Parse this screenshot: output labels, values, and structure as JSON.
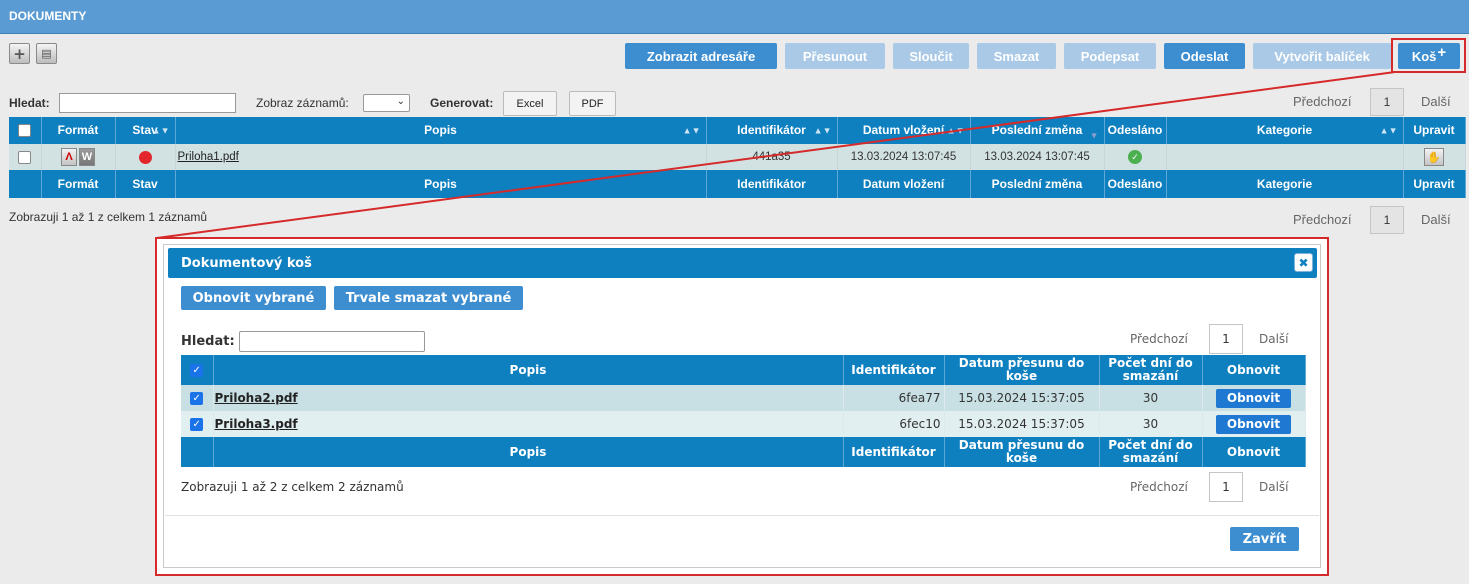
{
  "header": {
    "title": "DOKUMENTY"
  },
  "icons": {
    "add": "plus-icon",
    "export": "document-export-icon"
  },
  "toolbar": {
    "buttons": [
      {
        "label": "Zobrazit adresáře",
        "enabled": true
      },
      {
        "label": "Přesunout",
        "enabled": false
      },
      {
        "label": "Sloučit",
        "enabled": false
      },
      {
        "label": "Smazat",
        "enabled": false
      },
      {
        "label": "Podepsat",
        "enabled": false
      },
      {
        "label": "Odeslat",
        "enabled": true
      },
      {
        "label": "Vytvořit balíček",
        "enabled": false
      },
      {
        "label": "Koš",
        "enabled": true
      }
    ]
  },
  "filters": {
    "search_label": "Hledat:",
    "search_value": "",
    "show_label": "Zobraz záznamů:",
    "show_value": "",
    "generate_label": "Generovat:",
    "excel_label": "Excel",
    "pdf_label": "PDF"
  },
  "pager": {
    "prev": "Předchozí",
    "page": "1",
    "next": "Další"
  },
  "table": {
    "columns": [
      "Formát",
      "Stav",
      "Popis",
      "Identifikátor",
      "Datum vložení",
      "Poslední změna",
      "Odesláno",
      "Kategorie",
      "Upravit"
    ],
    "rows": [
      {
        "popis": "Priloha1.pdf",
        "identifikator": "441a35",
        "datum_vlozeni": "13.03.2024 13:07:45",
        "posledni_zmena": "13.03.2024 13:07:45",
        "kategorie": "",
        "stav_color": "#e3262c"
      }
    ],
    "summary": "Zobrazuji 1 až 1 z celkem 1 záznamů"
  },
  "modal": {
    "title": "Dokumentový koš",
    "restore_selected": "Obnovit vybrané",
    "delete_selected": "Trvale smazat vybrané",
    "search_label": "Hledat:",
    "search_value": "",
    "pager": {
      "prev": "Předchozí",
      "page": "1",
      "next": "Další"
    },
    "columns": [
      "Popis",
      "Identifikátor",
      "Datum přesunu do koše",
      "Počet dní do smazání",
      "Obnovit"
    ],
    "rows": [
      {
        "popis": "Priloha2.pdf",
        "identifikator": "6fea77",
        "datum": "15.03.2024 15:37:05",
        "dni": "30",
        "action": "Obnovit",
        "checked": true
      },
      {
        "popis": "Priloha3.pdf",
        "identifikator": "6fec10",
        "datum": "15.03.2024 15:37:05",
        "dni": "30",
        "action": "Obnovit",
        "checked": true
      }
    ],
    "summary": "Zobrazuji 1 až 2 z celkem 2 záznamů",
    "pager2": {
      "prev": "Předchozí",
      "page": "1",
      "next": "Další"
    },
    "close_label": "Zavřít"
  },
  "colors": {
    "header": "#5a9bd3",
    "grid_header": "#0e7fbf",
    "button": "#3d8ed1",
    "button_disabled": "#a9c9e6",
    "highlight": "#d62a2a"
  }
}
